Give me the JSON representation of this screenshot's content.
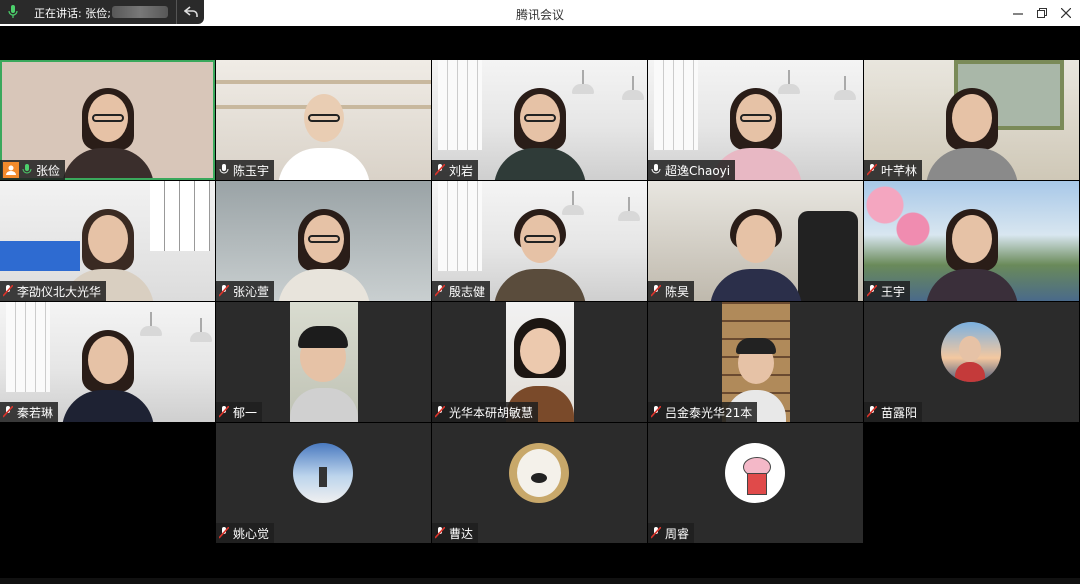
{
  "window": {
    "title": "腾讯会议",
    "speaking_label": "正在讲话: 张俭;",
    "controls": {
      "minimize": "minimize-icon",
      "restore": "restore-icon",
      "close": "close-icon"
    }
  },
  "participants": [
    {
      "name": "张俭",
      "style": "video",
      "mic": "on",
      "self": true
    },
    {
      "name": "陈玉宇",
      "style": "video",
      "mic": "on"
    },
    {
      "name": "刘岩",
      "style": "video",
      "mic": "muted"
    },
    {
      "name": "超逸Chaoyi",
      "style": "video",
      "mic": "on"
    },
    {
      "name": "叶芊林",
      "style": "video",
      "mic": "muted"
    },
    {
      "name": "李劭仪北大光华",
      "style": "video",
      "mic": "muted"
    },
    {
      "name": "张沁萱",
      "style": "video",
      "mic": "muted"
    },
    {
      "name": "殷志健",
      "style": "video",
      "mic": "muted"
    },
    {
      "name": "陈昊",
      "style": "video",
      "mic": "muted"
    },
    {
      "name": "王宇",
      "style": "video",
      "mic": "muted"
    },
    {
      "name": "秦若琳",
      "style": "video",
      "mic": "muted"
    },
    {
      "name": "郁一",
      "style": "video",
      "mic": "muted"
    },
    {
      "name": "光华本研胡敏慧",
      "style": "video",
      "mic": "muted"
    },
    {
      "name": "吕金泰光华21本",
      "style": "video",
      "mic": "muted"
    },
    {
      "name": "苗露阳",
      "style": "avatar",
      "mic": "muted"
    },
    {
      "name": "姚心觉",
      "style": "avatar",
      "mic": "muted"
    },
    {
      "name": "曹达",
      "style": "avatar",
      "mic": "muted"
    },
    {
      "name": "周睿",
      "style": "avatar",
      "mic": "muted"
    }
  ],
  "colors": {
    "muted": "#d9342b",
    "active_border": "#3aa85c",
    "self_badge": "#f28b2c"
  }
}
